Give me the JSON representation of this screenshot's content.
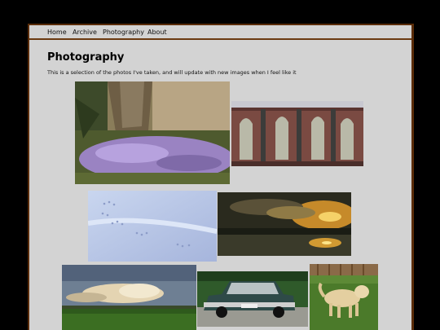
{
  "nav": {
    "items": [
      {
        "label": "Home"
      },
      {
        "label": "Archive"
      },
      {
        "label": "Photography"
      },
      {
        "label": "About"
      }
    ]
  },
  "page": {
    "title": "Photography",
    "intro": "This is a selection of the photos I've taken, and will update with new images when I feel like it"
  },
  "gallery": {
    "photos": [
      {
        "subject": "crocus flowers at tree base"
      },
      {
        "subject": "brick church with arched windows"
      },
      {
        "subject": "footprints in snow"
      },
      {
        "subject": "sunset over water"
      },
      {
        "subject": "clouds over green field"
      },
      {
        "subject": "vintage green car"
      },
      {
        "subject": "golden retriever on grass"
      }
    ]
  },
  "colors": {
    "background": "#000000",
    "border": "#5a2c08",
    "content": "#d3d3d3"
  }
}
